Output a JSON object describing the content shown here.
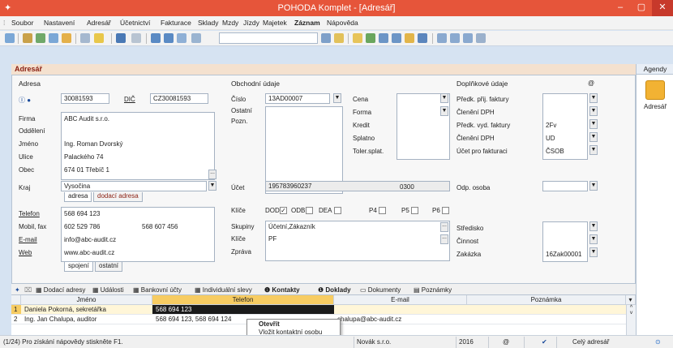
{
  "window": {
    "title": "POHODA Komplet - [Adresář]"
  },
  "menu": [
    "Soubor",
    "Nastavení",
    "Adresář",
    "Účetnictví",
    "Fakturace",
    "Sklady",
    "Mzdy",
    "Jízdy",
    "Majetek",
    "Záznam",
    "Nápověda"
  ],
  "pane": {
    "header": "Adresář",
    "agendy": "Agendy",
    "agendy_item": "Adresář"
  },
  "adresa": {
    "title": "Adresa",
    "ico": "30081593",
    "dic_label": "DIČ",
    "dic": "CZ30081593",
    "firma_label": "Firma",
    "firma": "ABC Audit s.r.o.",
    "oddeleni_label": "Oddělení",
    "jmeno_label": "Jméno",
    "jmeno": "Ing. Roman Dvorský",
    "ulice_label": "Ulice",
    "ulice": "Palackého 74",
    "obec_label": "Obec",
    "obec": "674 01  Třebíč 1",
    "kraj_label": "Kraj",
    "kraj": "Vysočina",
    "tab1": "adresa",
    "tab2": "dodací adresa",
    "telefon_label": "Telefon",
    "telefon": "568 694 123",
    "mobil_label": "Mobil, fax",
    "mobil": "602 529 786",
    "fax": "568 607 456",
    "email_label": "E-mail",
    "email": "info@abc-audit.cz",
    "web_label": "Web",
    "web": "www.abc-audit.cz",
    "tab3": "spojení",
    "tab4": "ostatní"
  },
  "obchod": {
    "title": "Obchodní údaje",
    "cislo_label": "Číslo",
    "cislo": "13AD00007",
    "ostatni_label": "Ostatní",
    "pozn_label": "Pozn.",
    "ucet_label": "Účet",
    "ucet": "195783960237",
    "ucet_kod": "0300",
    "klice_label": "Klíče",
    "dod": "DOD",
    "odb": "ODB",
    "dea": "DEA",
    "p4": "P4",
    "p5": "P5",
    "p6": "P6",
    "skupiny_label": "Skupiny",
    "skupiny": "Účetní,Zákazník",
    "klice2_label": "Klíče",
    "klice2": "PF",
    "zprava_label": "Zpráva"
  },
  "cena": {
    "cena": "Cena",
    "forma": "Forma",
    "kredit": "Kredit",
    "splatno": "Splatno",
    "toler": "Toler.splat."
  },
  "doplnkove": {
    "title": "Doplňkové údaje",
    "at": "@",
    "predk_prij": "Předk. přij. faktury",
    "cleneni1": "Členění DPH",
    "predk_vyd": "Předk. vyd. faktury",
    "predk_vyd_val": "2Fv",
    "cleneni2": "Členění DPH",
    "cleneni2_val": "UD",
    "ucet_fakt": "Účet pro fakturaci",
    "ucet_fakt_val": "ČSOB",
    "odp_osoba": "Odp. osoba",
    "stredisko": "Středisko",
    "cinnost": "Činnost",
    "zakazka": "Zakázka",
    "zakazka_val": "16Zak00001"
  },
  "bottom_tabs": [
    "Dodací adresy",
    "Události",
    "Bankovní účty",
    "Individuální slevy",
    "Kontakty",
    "Doklady",
    "Dokumenty",
    "Poznámky"
  ],
  "grid": {
    "headers": [
      "Jméno",
      "Telefon",
      "E-mail",
      "Poznámka"
    ],
    "rows": [
      {
        "n": "1",
        "jmeno": "Daniela Pokorná, sekretářka",
        "telefon": "568 694 123",
        "email": "",
        "poznamka": ""
      },
      {
        "n": "2",
        "jmeno": "Ing. Jan Chalupa, auditor",
        "telefon": "568 694 123, 568 694 124",
        "email": "chalupa@abc-audit.cz",
        "poznamka": ""
      }
    ]
  },
  "context_menu": {
    "open": "Otevřít",
    "insert": "Vložit kontaktní osobu"
  },
  "status": {
    "help": "(1/24) Pro získání nápovědy stiskněte F1.",
    "company": "Novák s.r.o.",
    "year": "2016",
    "at": "@",
    "filter": "Celý adresář"
  }
}
